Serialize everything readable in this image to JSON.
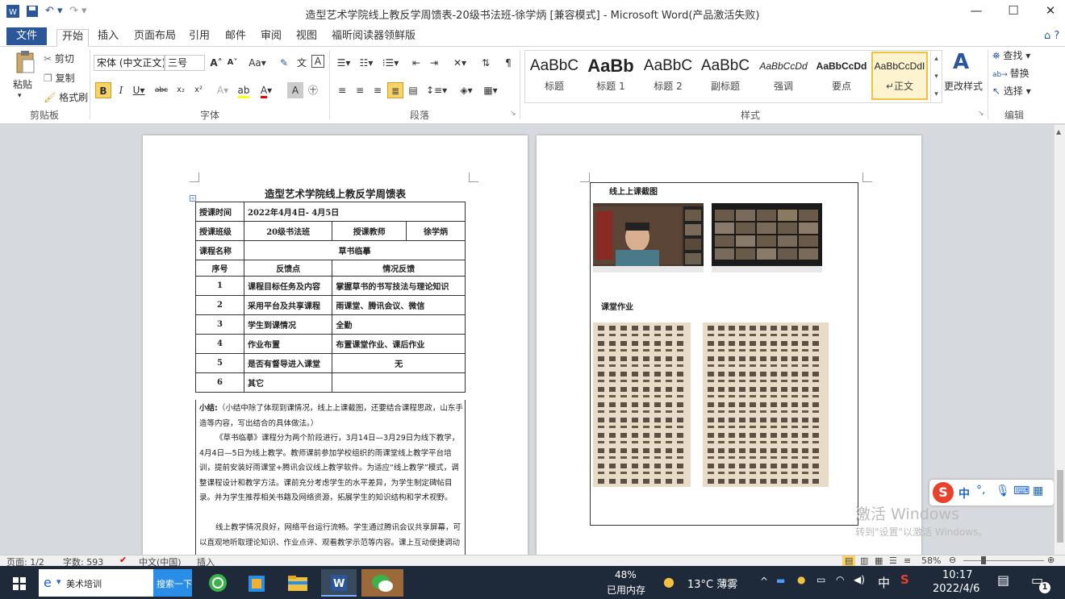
{
  "window": {
    "title": "造型艺术学院线上教反学周馈表-20级书法班-徐学炳 [兼容模式] - Microsoft Word(产品激活失败)",
    "minimize": "—",
    "maximize": "☐",
    "close": "✕"
  },
  "tabs": [
    "文件",
    "开始",
    "插入",
    "页面布局",
    "引用",
    "邮件",
    "审阅",
    "视图",
    "福昕阅读器领鲜版"
  ],
  "ribbon": {
    "clipboard": {
      "paste": "粘贴",
      "cut": "剪切",
      "copy": "复制",
      "format_painter": "格式刷",
      "label": "剪贴板"
    },
    "font": {
      "font_name": "宋体 (中文正文)",
      "font_size": "三号",
      "label": "字体"
    },
    "paragraph": {
      "label": "段落"
    },
    "styles": {
      "items": [
        {
          "preview": "AaBbC",
          "name": "标题"
        },
        {
          "preview": "AaBb",
          "name": "标题 1"
        },
        {
          "preview": "AaBbC",
          "name": "标题 2"
        },
        {
          "preview": "AaBbC",
          "name": "副标题"
        },
        {
          "preview": "AaBbCcDd",
          "name": "强调"
        },
        {
          "preview": "AaBbCcDd",
          "name": "要点"
        },
        {
          "preview": "AaBbCcDdI",
          "name": "↵正文"
        }
      ],
      "change_styles": "更改样式",
      "label": "样式"
    },
    "editing": {
      "find": "查找",
      "replace": "替换",
      "select": "选择",
      "label": "编辑"
    }
  },
  "doc": {
    "page1": {
      "title": "造型艺术学院线上教反学周馈表",
      "r1": {
        "k1": "授课时间",
        "v1": "2022年4月4日- 4月5日"
      },
      "r2": {
        "k1": "授课班级",
        "v1": "20级书法班",
        "k2": "授课教师",
        "v2": "徐学炳"
      },
      "r3": {
        "k1": "课程名称",
        "v1": "草书临摹"
      },
      "head": {
        "no": "序号",
        "point": "反馈点",
        "fb": "情况反馈"
      },
      "rows": [
        {
          "no": "1",
          "point": "课程目标任务及内容",
          "fb": "掌握草书的书写技法与理论知识"
        },
        {
          "no": "2",
          "point": "采用平台及共享课程",
          "fb": "雨课堂、腾讯会议、微信"
        },
        {
          "no": "3",
          "point": "学生到课情况",
          "fb": "全勤"
        },
        {
          "no": "4",
          "point": "作业布置",
          "fb": "布置课堂作业、课后作业"
        },
        {
          "no": "5",
          "point": "是否有督导进入课堂",
          "fb": "无"
        },
        {
          "no": "6",
          "point": "其它",
          "fb": ""
        }
      ],
      "summary_label": "小结:",
      "summary_hint": "（小结中除了体现到课情况，线上上课截图，还要结合课程思政，山东手造等内容，写出结合的具体做法。）",
      "para1": "《草书临摹》课程分为两个阶段进行，3月14日—3月29日为线下教学，4月4日—5日为线上教学。教师课前参加学校组织的雨课堂线上教学平台培训，提前安装好雨课堂+腾讯会议线上教学软件。为适应“线上教学”模式，调整课程设计和教学方法。课前充分考虑学生的水平差异，为学生制定碑帖目录。并为学生推荐相关书籍及网络资源，拓展学生的知识结构和学术视野。",
      "para2": "线上教学情况良好，网络平台运行流畅。学生通过腾讯会议共享屏幕，可以直观地听取理论知识、作业点评、观看教学示范等内容。课上互动便捷调动"
    },
    "page2": {
      "screenshot_label": "线上上课截图",
      "homework_label": "课堂作业"
    }
  },
  "watermark": {
    "line1": "激活 Windows",
    "line2": "转到\"设置\"以激活 Windows。"
  },
  "status": {
    "page": "页面: 1/2",
    "words": "字数: 593",
    "lang": "中文(中国)",
    "mode": "插入",
    "zoom": "58%"
  },
  "taskbar": {
    "browser_tab": "美术培训",
    "search_btn": "搜索一下",
    "mem_pct": "48%",
    "mem_label": "已用内存",
    "weather": "13°C 薄雾",
    "ime": "中",
    "time": "10:17",
    "date": "2022/4/6",
    "notif_count": "1"
  }
}
